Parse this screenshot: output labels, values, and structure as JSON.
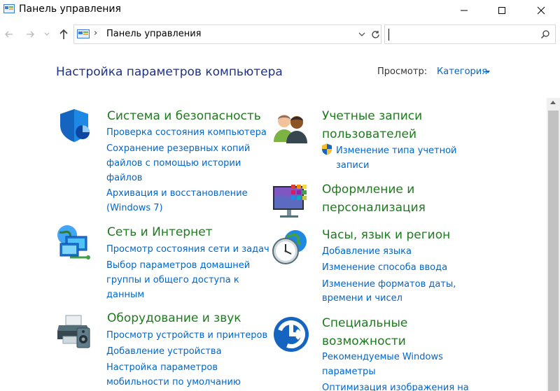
{
  "window": {
    "title": "Панель управления"
  },
  "address_bar": {
    "path": "Панель управления",
    "separator": "›"
  },
  "search": {
    "placeholder": ""
  },
  "header": {
    "title": "Настройка параметров компьютера",
    "view_label": "Просмотр:",
    "view_value": "Категория"
  },
  "categories": [
    {
      "title": "Система и безопасность",
      "icon": "shield-icon",
      "links": [
        "Проверка состояния компьютера",
        "Сохранение резервных копий",
        "файлов с помощью истории",
        "файлов",
        "Архивация и восстановление",
        "(Windows 7)"
      ]
    },
    {
      "title": "Сеть и Интернет",
      "icon": "network-icon",
      "links": [
        "Просмотр состояния сети и задач",
        "Выбор параметров домашней",
        "группы и общего доступа к",
        "данным"
      ]
    },
    {
      "title": "Оборудование и звук",
      "icon": "printer-speaker-icon",
      "links": [
        "Просмотр устройств и принтеров",
        "Добавление устройства",
        "Настройка параметров",
        "мобильности по умолчанию"
      ]
    },
    {
      "title_lines": [
        "Учетные записи",
        "пользователей"
      ],
      "icon": "users-icon",
      "links": [
        "Изменение типа учетной",
        "записи"
      ]
    },
    {
      "title_lines": [
        "Оформление и",
        "персонализация"
      ],
      "icon": "appearance-icon",
      "links": []
    },
    {
      "title": "Часы, язык и регион",
      "icon": "clock-globe-icon",
      "links": [
        "Добавление языка",
        "Изменение способа ввода",
        "Изменение форматов даты,",
        "времени и чисел"
      ]
    },
    {
      "title_lines": [
        "Специальные",
        "возможности"
      ],
      "icon": "accessibility-icon",
      "links": [
        "Рекомендуемые Windows",
        "параметры",
        "Оптимизация изображения на"
      ]
    }
  ],
  "colors": {
    "title_blue": "#1e3287",
    "category_green": "#1f7a1f",
    "link_blue": "#0066cc"
  }
}
